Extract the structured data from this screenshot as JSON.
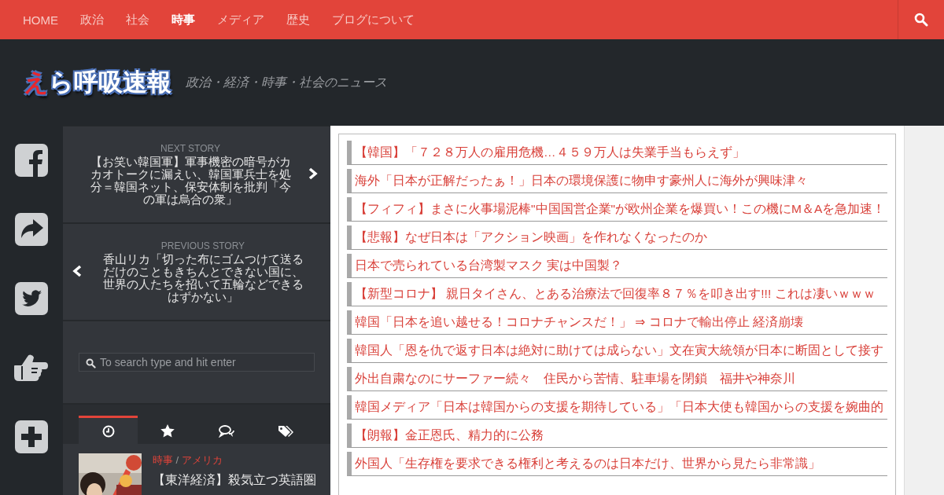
{
  "nav": {
    "items": [
      {
        "label": "HOME",
        "selected": false
      },
      {
        "label": "政治",
        "selected": false
      },
      {
        "label": "社会",
        "selected": false
      },
      {
        "label": "時事",
        "selected": true
      },
      {
        "label": "メディア",
        "selected": false
      },
      {
        "label": "歴史",
        "selected": false
      },
      {
        "label": "ブログについて",
        "selected": false
      }
    ]
  },
  "header": {
    "logo": "えら呼吸速報",
    "tagline": "政治・経済・時事・社会のニュース"
  },
  "social": [
    {
      "kind": "facebook"
    },
    {
      "kind": "share"
    },
    {
      "kind": "twitter"
    },
    {
      "kind": "like"
    },
    {
      "kind": "plus"
    }
  ],
  "sidebar": {
    "next_story": {
      "label": "NEXT STORY",
      "title": "【お笑い韓国軍】軍事機密の暗号がカカオトークに漏えい、韓国軍兵士を処分＝韓国ネット、保安体制を批判「今の軍は烏合の衆」"
    },
    "previous_story": {
      "label": "PREVIOUS STORY",
      "title": "香山リカ「切った布にゴムつけて送るだけのこともきちんとできない国に、世界の人たちを招いて五輪などできるはずかない」"
    },
    "search": {
      "placeholder": "To search type and hit enter"
    },
    "tabs": [
      {
        "kind": "recent",
        "selected": true
      },
      {
        "kind": "popular",
        "selected": false
      },
      {
        "kind": "comments",
        "selected": false
      },
      {
        "kind": "tags",
        "selected": false
      }
    ],
    "post": {
      "categories": [
        "時事",
        "アメリカ"
      ],
      "separator": "/",
      "title": "【東洋経済】殺気立つ英語圏"
    }
  },
  "news": [
    {
      "title": "【韓国】「７２８万人の雇用危機…４５９万人は失業手当もらえず」"
    },
    {
      "title": "海外「日本が正解だったぁ！」日本の環境保護に物申す豪州人に海外が興味津々"
    },
    {
      "title": "【フィフィ】まさに火事場泥棒\"中国国営企業\"が欧州企業を爆買い！この機にM＆Aを急加速！"
    },
    {
      "title": "【悲報】なぜ日本は「アクション映画」を作れなくなったのか"
    },
    {
      "title": "日本で売られている台湾製マスク 実は中国製？"
    },
    {
      "title": "【新型コロナ】 親日タイさん、とある治療法で回復率８７％を叩き出す!!! これは凄いｗｗｗ"
    },
    {
      "title": "韓国「日本を追い越せる！コロナチャンスだ！」 ⇒ コロナで輸出停止 経済崩壊"
    },
    {
      "title": "韓国人「恩を仇で返す日本は絶対に助けては成らない」文在寅大統領が日本に断固として接す"
    },
    {
      "title": "外出自粛なのにサーファー続々　住民から苦情、駐車場を閉鎖　福井や神奈川"
    },
    {
      "title": "韓国メディア「日本は韓国からの支援を期待している」「日本大使も韓国からの支援を婉曲的"
    },
    {
      "title": "【朗報】金正恩氏、精力的に公務"
    },
    {
      "title": "外国人「生存権を要求できる権利と考えるのは日本だけ、世界から見たら非常識」"
    }
  ]
}
